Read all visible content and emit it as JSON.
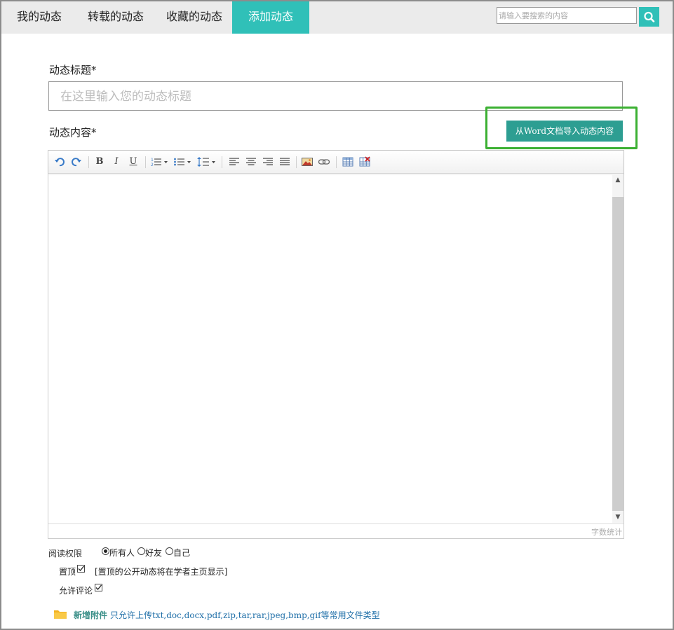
{
  "nav": {
    "tabs": [
      {
        "label": "我的动态"
      },
      {
        "label": "转载的动态"
      },
      {
        "label": "收藏的动态"
      },
      {
        "label": "添加动态",
        "active": true
      }
    ],
    "search_placeholder": "请输入要搜索的内容",
    "search_icon": "search-icon"
  },
  "form": {
    "title_label": "动态标题*",
    "title_placeholder": "在这里输入您的动态标题",
    "content_label": "动态内容*",
    "import_button": "从Word文档导入动态内容"
  },
  "editor": {
    "toolbar": {
      "bold": "B",
      "italic": "I",
      "underline": "U"
    },
    "word_count": "字数统计"
  },
  "options": {
    "read_permission_label": "阅读权限",
    "permission_options": [
      "所有人",
      "好友",
      "自己"
    ],
    "permission_selected": "所有人",
    "pin_label": "置顶",
    "pin_checked": true,
    "pin_note": "[置顶的公开动态将在学者主页显示]",
    "allow_comment_label": "允许评论",
    "allow_comment_checked": true
  },
  "attachment": {
    "link": "新增附件",
    "hint": "只允许上传txt,doc,docx,pdf,zip,tar,rar,jpeg,bmp,gif等常用文件类型"
  },
  "colors": {
    "accent": "#30c0b8",
    "import_button": "#2d9e92",
    "highlight_box": "#3bb032"
  }
}
